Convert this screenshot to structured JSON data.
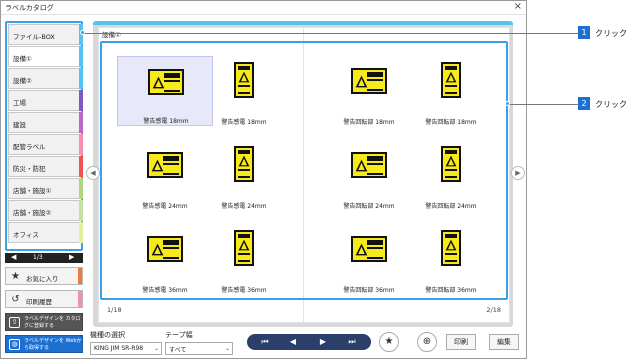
{
  "window": {
    "title": "ラベルカタログ",
    "close": "×"
  },
  "sidebar": {
    "categories": [
      {
        "label": "ファイル-BOX",
        "color": "#5bc0f0"
      },
      {
        "label": "設備①",
        "color": "#4fc3f7"
      },
      {
        "label": "設備②",
        "color": "#4fc3f7"
      },
      {
        "label": "工場",
        "color": "#7e57c2"
      },
      {
        "label": "建設",
        "color": "#ba68c8"
      },
      {
        "label": "配管ラベル",
        "color": "#f48fb1"
      },
      {
        "label": "防災・防犯",
        "color": "#ef5350"
      },
      {
        "label": "店舗・施設①",
        "color": "#aed581"
      },
      {
        "label": "店舗・施設②",
        "color": "#c5e1a5"
      },
      {
        "label": "オフィス",
        "color": "#e6ee9c"
      }
    ],
    "pager": {
      "prev": "◀",
      "text": "1/3",
      "next": "▶"
    },
    "favorites": "お気に入り",
    "history": "印刷履歴",
    "register": "ラベルデザインを カタログに登録する",
    "web": "ラベルデザインを Webから取得する"
  },
  "catalog": {
    "section": "設備①",
    "page_left": "1/18",
    "page_right": "2/18",
    "prev_arrow": "◀",
    "next_arrow": "▶",
    "labels_left": [
      "警告感電 18mm",
      "警告感電 18mm",
      "警告感電 24mm",
      "警告感電 24mm",
      "警告感電 36mm",
      "警告感電 36mm"
    ],
    "labels_right": [
      "警告回転部 18mm",
      "警告回転部 18mm",
      "警告回転部 24mm",
      "警告回転部 24mm",
      "警告回転部 36mm",
      "警告回転部 36mm"
    ]
  },
  "controls": {
    "model_label": "機種の選択",
    "model_value": "KING JIM SR-R98",
    "tape_label": "テープ幅",
    "tape_value": "すべて",
    "nav": [
      "⏮",
      "◀",
      "▶",
      "⏭"
    ],
    "favorite_icon": "★",
    "zoom_icon": "⊕",
    "print": "印刷",
    "edit": "編集"
  },
  "callouts": [
    {
      "num": "1",
      "text": "クリック"
    },
    {
      "num": "2",
      "text": "クリック"
    }
  ],
  "colors": {
    "accent": "#3aa0e8",
    "nav": "#2c3f6b",
    "badge": "#1d6fd0",
    "sign": "#f7ea1a"
  }
}
